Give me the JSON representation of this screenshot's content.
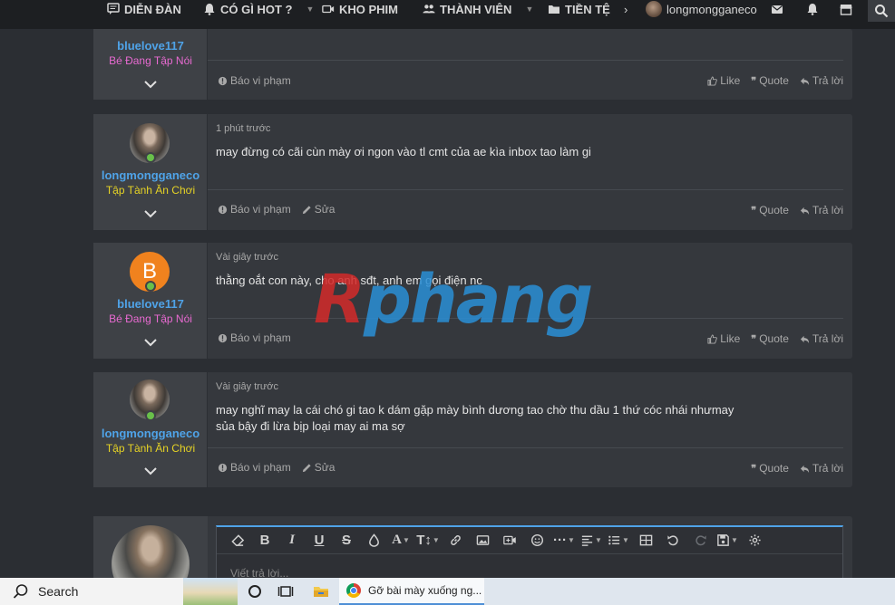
{
  "nav": {
    "items": [
      {
        "label": "DIỄN ĐÀN"
      },
      {
        "label": "CÓ GÌ HOT ?"
      },
      {
        "label": "KHO PHIM"
      },
      {
        "label": "THÀNH VIÊN"
      },
      {
        "label": "TIỀN TỆ"
      }
    ],
    "username": "longmongganeco"
  },
  "posts": [
    {
      "username": "bluelove117",
      "user_title": "Bé Đang Tập Nói",
      "meta": "",
      "content": "",
      "report": "Báo vi phạm",
      "actions": [
        "Like",
        "Quote",
        "Trả lời"
      ]
    },
    {
      "username": "longmongganeco",
      "user_title": "Tập Tành Ăn Chơi",
      "meta": "1 phút trước",
      "content": "may đừng có cãi cùn mày ơi ngon vào tl cmt của ae kìa inbox tao làm gi",
      "report": "Báo vi phạm",
      "edit": "Sửa",
      "actions": [
        "Quote",
        "Trả lời"
      ]
    },
    {
      "username": "bluelove117",
      "avatar_letter": "B",
      "user_title": "Bé Đang Tập Nói",
      "meta": "Vài giây trước",
      "content": "thằng oắt con này, cho anh sđt, anh em gọi điện nc",
      "report": "Báo vi phạm",
      "actions": [
        "Like",
        "Quote",
        "Trả lời"
      ]
    },
    {
      "username": "longmongganeco",
      "user_title": "Tập Tành Ăn Chơi",
      "meta": "Vài giây trước",
      "content_lines": [
        "may nghĩ may la cái chó gi tao k dám gặp mày bình dương tao chờ thu dầu 1 thứ cóc nhái nhưmay",
        "sủa bậy đi lừa bịp loại may ai ma sợ"
      ],
      "report": "Báo vi phạm",
      "edit": "Sửa",
      "actions": [
        "Quote",
        "Trả lời"
      ]
    }
  ],
  "watermark": {
    "first": "R",
    "rest": "phang"
  },
  "editor": {
    "placeholder": "Viết trả lời..."
  },
  "taskbar": {
    "search": "Search",
    "chrome_title": "Gỡ bài mày xuống ng..."
  },
  "colors": {
    "username": "#4fa3e8",
    "title_pink": "#e86ad1",
    "title_yellow": "#e6d325",
    "online": "#69c04a",
    "avatar_orange": "#f0821e"
  }
}
